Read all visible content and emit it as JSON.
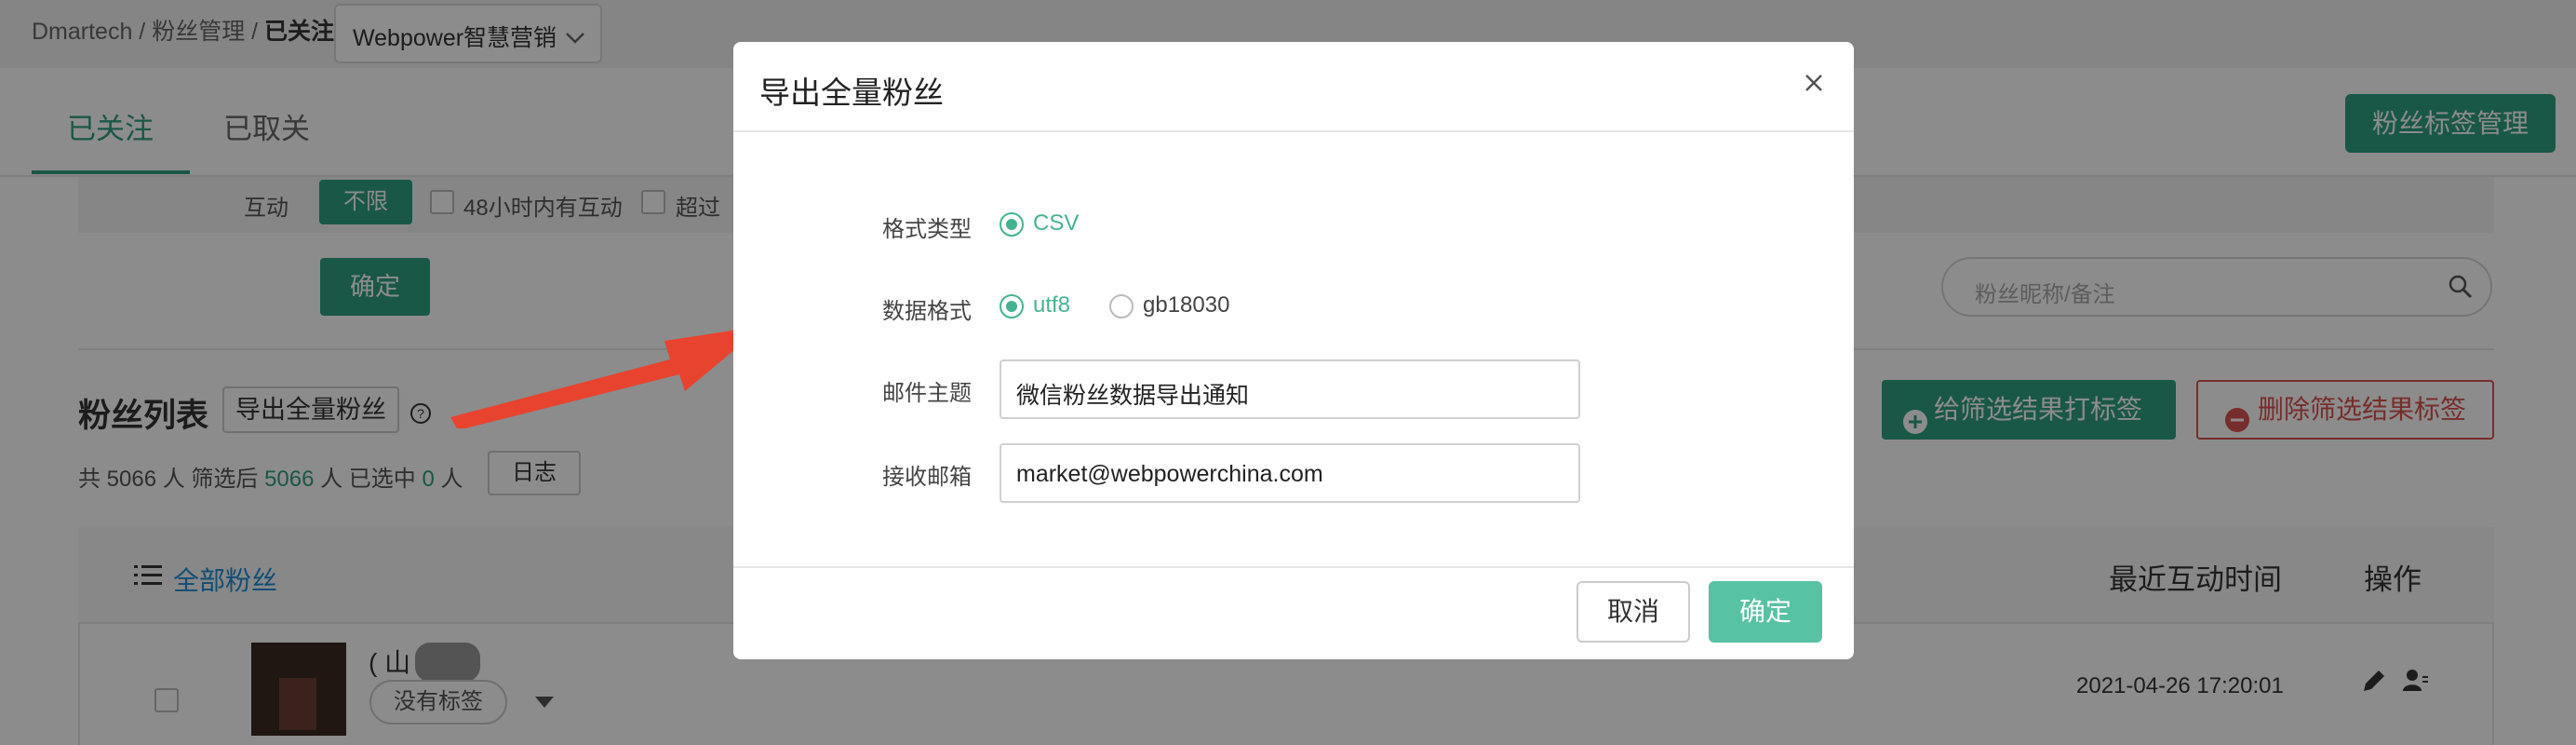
{
  "header": {
    "breadcrumb_prefix": "Dmartech / 粉丝管理 / ",
    "breadcrumb_current": "已关注",
    "company_select": "Webpower智慧营销"
  },
  "tabs": [
    {
      "label": "已关注",
      "active": true
    },
    {
      "label": "已取关",
      "active": false
    }
  ],
  "tag_manage_button": "粉丝标签管理",
  "filters": {
    "interaction_label": "互动",
    "unlimited": "不限",
    "within_48h": "48小时内有互动",
    "over": "超过",
    "confirm": "确定"
  },
  "search": {
    "placeholder": "粉丝昵称/备注"
  },
  "list": {
    "title": "粉丝列表",
    "export_button": "导出全量粉丝",
    "tag_results_button": "给筛选结果打标签",
    "remove_tags_button": "删除筛选结果标签",
    "count_total_text": "共 5066 人  筛选后",
    "count_filtered": "5066",
    "count_selected_text": "人 已选中",
    "count_selected": "0",
    "count_unit": "人",
    "log_button": "日志",
    "all_fans": "全部粉丝",
    "col_last_interaction": "最近互动时间",
    "col_actions": "操作",
    "rows": [
      {
        "name": "( 山          晨 )",
        "tag": "没有标签",
        "last_interaction": "2021-04-26 17:20:01"
      }
    ]
  },
  "modal": {
    "title": "导出全量粉丝",
    "format_type_label": "格式类型",
    "format_csv": "CSV",
    "data_format_label": "数据格式",
    "encoding_utf8": "utf8",
    "encoding_gb18030": "gb18030",
    "subject_label": "邮件主题",
    "subject_value": "微信粉丝数据导出通知",
    "email_label": "接收邮箱",
    "email_value": "market@webpowerchina.com",
    "cancel": "取消",
    "ok": "确定"
  },
  "colors": {
    "brand_green": "#2f9e82",
    "modal_green": "#58c2a4",
    "danger_red": "#d9534f",
    "link_blue": "#1f8ed6",
    "arrow_red": "#e8432e"
  },
  "icons": [
    "chevron-down-icon",
    "search-icon",
    "help-icon",
    "plus-circle-icon",
    "minus-circle-icon",
    "list-icon",
    "edit-icon",
    "user-icon",
    "close-icon",
    "arrow-annotation"
  ]
}
